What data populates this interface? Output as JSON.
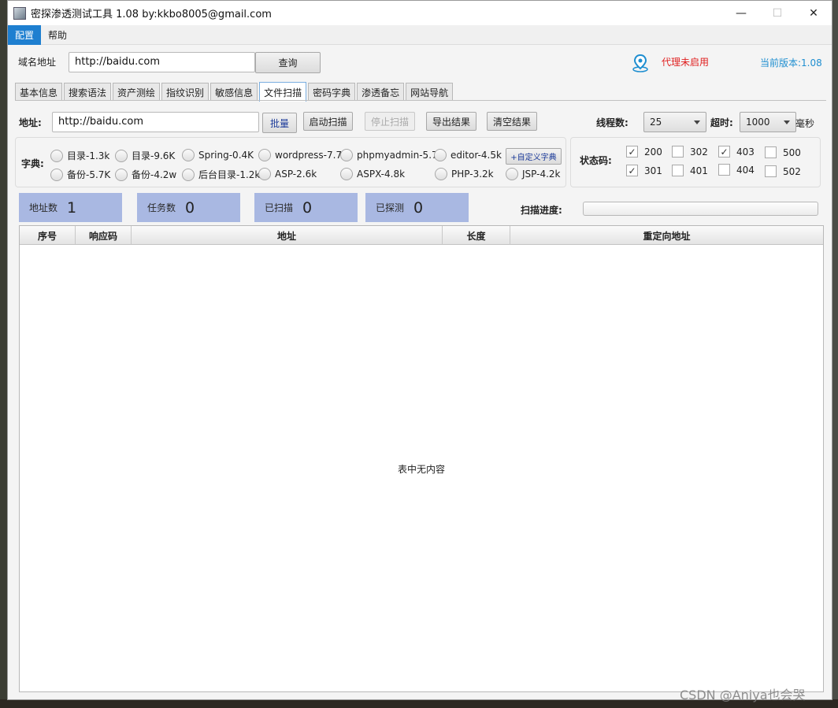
{
  "window": {
    "title": "密探渗透测试工具 1.08 by:kkbo8005@gmail.com"
  },
  "menu": [
    {
      "label": "配置"
    },
    {
      "label": "帮助"
    }
  ],
  "domain": {
    "label": "域名地址",
    "value": "http://baidu.com",
    "query_button": "查询",
    "proxy_status": "代理未启用",
    "version": "当前版本:1.08"
  },
  "tabs": [
    "基本信息",
    "搜索语法",
    "资产测绘",
    "指纹识别",
    "敏感信息",
    "文件扫描",
    "密码字典",
    "渗透备忘",
    "网站导航"
  ],
  "scan": {
    "address_label": "地址:",
    "address_value": "http://baidu.com",
    "batch_button": "批量",
    "start_button": "启动扫描",
    "stop_button": "停止扫描",
    "export_button": "导出结果",
    "clear_button": "清空结果",
    "threads_label": "线程数:",
    "threads_value": "25",
    "timeout_label": "超时:",
    "timeout_value": "1000",
    "timeout_unit": "毫秒"
  },
  "dictionary": {
    "label": "字典:",
    "options": [
      "目录-1.3k",
      "目录-9.6K",
      "Spring-0.4K",
      "wordpress-7.7k",
      "phpmyadmin-5.7",
      "editor-4.5k",
      "备份-5.7K",
      "备份-4.2w",
      "后台目录-1.2k",
      "ASP-2.6k",
      "ASPX-4.8k",
      "PHP-3.2k",
      "JSP-4.2k"
    ],
    "custom_button": "+自定义字典"
  },
  "status_codes": {
    "label": "状态码:",
    "codes": [
      {
        "code": "200",
        "checked": true
      },
      {
        "code": "302",
        "checked": false
      },
      {
        "code": "403",
        "checked": true
      },
      {
        "code": "500",
        "checked": false
      },
      {
        "code": "301",
        "checked": true
      },
      {
        "code": "401",
        "checked": false
      },
      {
        "code": "404",
        "checked": false
      },
      {
        "code": "502",
        "checked": false
      }
    ]
  },
  "stats": [
    {
      "label": "地址数",
      "value": "1"
    },
    {
      "label": "任务数",
      "value": "0"
    },
    {
      "label": "已扫描",
      "value": "0"
    },
    {
      "label": "已探测",
      "value": "0"
    }
  ],
  "progress": {
    "label": "扫描进度:",
    "value": 0
  },
  "table": {
    "columns": [
      "序号",
      "响应码",
      "地址",
      "长度",
      "重定向地址"
    ],
    "empty_text": "表中无内容"
  },
  "watermark": "CSDN @Aniya也会哭",
  "colors": {
    "accent": "#1e7fd0",
    "proxy": "#e02020",
    "version": "#1e8ed0",
    "stat_bg": "#a9b8e2"
  }
}
